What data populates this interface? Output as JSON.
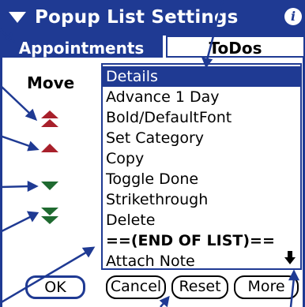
{
  "titlebar": {
    "title": "Popup List Settings",
    "menu_icon": "triangle-down-icon",
    "info_icon": "info-icon",
    "info_glyph": "i"
  },
  "tabs": [
    {
      "label": "Appointments",
      "active": true
    },
    {
      "label": "ToDos",
      "active": false
    }
  ],
  "move": {
    "label": "Move",
    "buttons": [
      "move-to-top",
      "move-up",
      "move-down",
      "move-to-bottom"
    ]
  },
  "list": {
    "items": [
      {
        "label": "Details",
        "selected": true
      },
      {
        "label": "Advance 1 Day"
      },
      {
        "label": "Bold/DefaultFont"
      },
      {
        "label": "Set Category"
      },
      {
        "label": "Copy"
      },
      {
        "label": "Toggle Done"
      },
      {
        "label": "Strikethrough"
      },
      {
        "label": "Delete"
      },
      {
        "label": "==(END OF LIST)==",
        "bold": true
      },
      {
        "label": "Attach Note"
      }
    ]
  },
  "buttons": {
    "ok": "OK",
    "cancel": "Cancel",
    "reset": "Reset",
    "more": "More"
  },
  "colors": {
    "accent": "#1f3a93",
    "move_up": "#a8202b",
    "move_down": "#1f6a30",
    "annotation": "#1f3a93"
  }
}
